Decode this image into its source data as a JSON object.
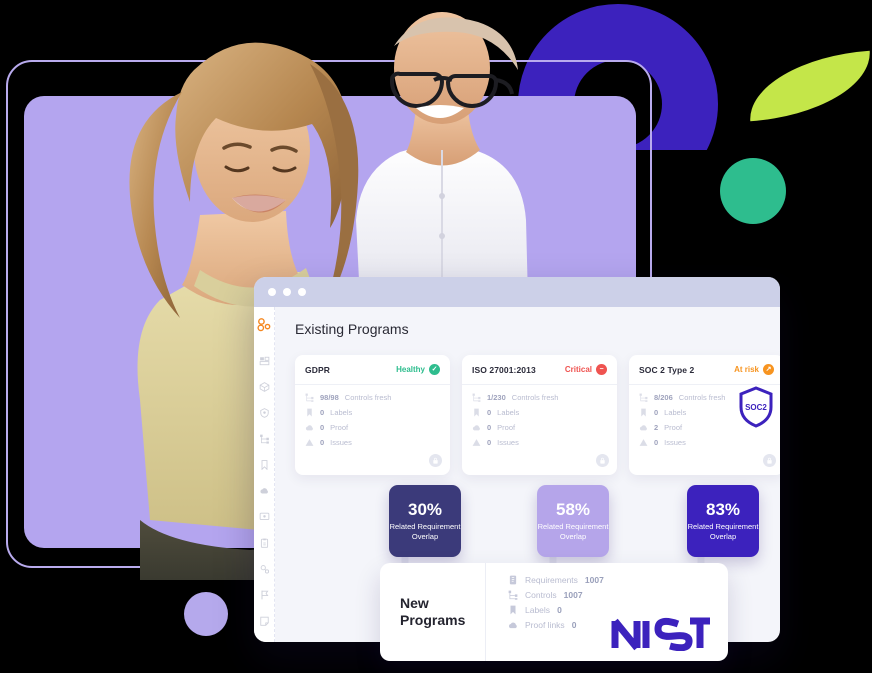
{
  "window": {
    "page_title": "Existing Programs",
    "logo": "three-circles-logo",
    "traffic_lights": [
      "close",
      "minimize",
      "maximize"
    ],
    "sidebar_icons": [
      "dashboard-icon",
      "box-icon",
      "shield-icon",
      "hierarchy-icon",
      "bookmark-icon",
      "cloud-icon",
      "monitor-icon",
      "clipboard-icon",
      "settings-gear-icon",
      "flag-icon",
      "note-icon"
    ]
  },
  "programs": [
    {
      "name": "GDPR",
      "status": "Healthy",
      "status_color": "#2ebd8e",
      "status_icon": "check-circle-icon",
      "rows": [
        {
          "icon": "hierarchy-icon",
          "value": "98/98",
          "label": "Controls fresh"
        },
        {
          "icon": "bookmark-icon",
          "value": "0",
          "label": "Labels"
        },
        {
          "icon": "cloud-icon",
          "value": "0",
          "label": "Proof"
        },
        {
          "icon": "warning-icon",
          "value": "0",
          "label": "Issues"
        }
      ],
      "badge": {
        "percent": "30%",
        "label": "Related Requirement Overlap",
        "color": "#3b3a7a"
      }
    },
    {
      "name": "ISO 27001:2013",
      "status": "Critical",
      "status_color": "#ef5350",
      "status_icon": "alert-circle-icon",
      "rows": [
        {
          "icon": "hierarchy-icon",
          "value": "1/230",
          "label": "Controls fresh"
        },
        {
          "icon": "bookmark-icon",
          "value": "0",
          "label": "Labels"
        },
        {
          "icon": "cloud-icon",
          "value": "0",
          "label": "Proof"
        },
        {
          "icon": "warning-icon",
          "value": "0",
          "label": "Issues"
        }
      ],
      "badge": {
        "percent": "58%",
        "label": "Related Requirement Overlap",
        "color": "#b5a5ea"
      }
    },
    {
      "name": "SOC 2 Type 2",
      "status": "At risk",
      "status_color": "#f79420",
      "status_icon": "arrow-circle-icon",
      "emblem": "SOC2",
      "rows": [
        {
          "icon": "hierarchy-icon",
          "value": "8/206",
          "label": "Controls fresh"
        },
        {
          "icon": "bookmark-icon",
          "value": "0",
          "label": "Labels"
        },
        {
          "icon": "cloud-icon",
          "value": "2",
          "label": "Proof"
        },
        {
          "icon": "warning-icon",
          "value": "0",
          "label": "Issues"
        }
      ],
      "badge": {
        "percent": "83%",
        "label": "Related Requirement Overlap",
        "color": "#3c22bd"
      }
    }
  ],
  "new_programs": {
    "title_line1": "New",
    "title_line2": "Programs",
    "rows": [
      {
        "icon": "document-icon",
        "label": "Requirements",
        "value": "1007"
      },
      {
        "icon": "hierarchy-icon",
        "label": "Controls",
        "value": "1007"
      },
      {
        "icon": "bookmark-icon",
        "label": "Labels",
        "value": "0"
      },
      {
        "icon": "cloud-icon",
        "label": "Proof links",
        "value": "0"
      }
    ],
    "logo_text": "NIST",
    "logo_color": "#3c22bd"
  },
  "decor": {
    "ring_color": "#3c22bd",
    "leaf_color": "#c4e649",
    "circle_color": "#2ebd8e",
    "dot_color": "#b5a9ec",
    "panel_color": "#b4a5ef"
  }
}
